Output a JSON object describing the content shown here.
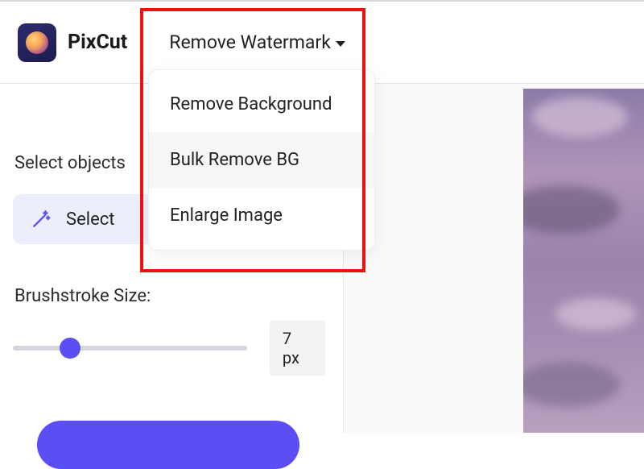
{
  "brand": "PixCut",
  "nav": {
    "remove_watermark": "Remove Watermark"
  },
  "dropdown": {
    "items": [
      {
        "label": "Remove Background"
      },
      {
        "label": "Bulk Remove BG"
      },
      {
        "label": "Enlarge Image"
      }
    ]
  },
  "sidebar": {
    "select_objects_title": "Select objects",
    "select_button": "Select",
    "brush_label": "Brushstroke Size:",
    "brush_value": "7 px"
  }
}
